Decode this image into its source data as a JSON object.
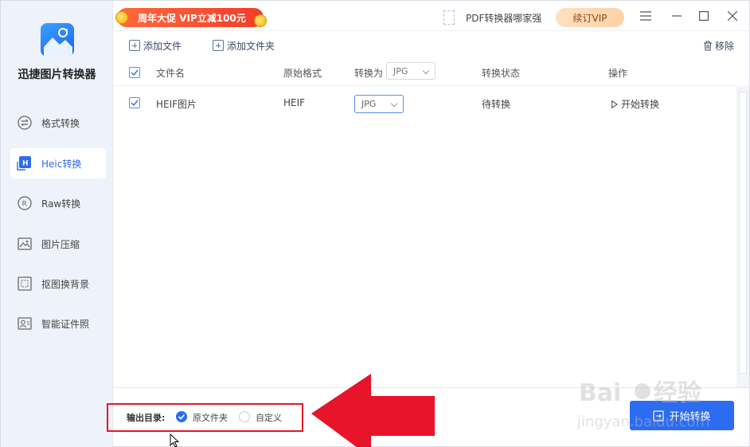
{
  "app": {
    "title": "迅捷图片转换器"
  },
  "sidebar": {
    "items": [
      {
        "label": "格式转换",
        "icon": "format-convert-icon",
        "active": false
      },
      {
        "label": "Heic转换",
        "icon": "heic-icon",
        "active": true
      },
      {
        "label": "Raw转换",
        "icon": "raw-icon",
        "active": false
      },
      {
        "label": "图片压缩",
        "icon": "image-compress-icon",
        "active": false
      },
      {
        "label": "抠图换背景",
        "icon": "cutout-icon",
        "active": false
      },
      {
        "label": "智能证件照",
        "icon": "id-photo-icon",
        "active": false
      }
    ]
  },
  "topbar": {
    "promo": "周年大促 VIP立减100元",
    "pdf_link": "PDF转换器哪家强",
    "vip_button": "续订VIP"
  },
  "toolbar": {
    "add_file": "添加文件",
    "add_folder": "添加文件夹",
    "remove": "移除"
  },
  "table": {
    "headers": {
      "filename": "文件名",
      "original_format": "原始格式",
      "convert_to": "转换为",
      "convert_to_value": "JPG",
      "status": "转换状态",
      "action": "操作"
    },
    "rows": [
      {
        "filename": "HEIF图片",
        "original_format": "HEIF",
        "target_format": "JPG",
        "status": "待转换",
        "action": "开始转换",
        "checked": true
      }
    ]
  },
  "output": {
    "label": "输出目录:",
    "options": [
      {
        "label": "原文件夹",
        "selected": true
      },
      {
        "label": "自定义",
        "selected": false
      }
    ]
  },
  "start_button": "开始转换",
  "colors": {
    "accent": "#2c6cf0",
    "annotation": "#e8142a",
    "promo": "#f23c2a"
  }
}
